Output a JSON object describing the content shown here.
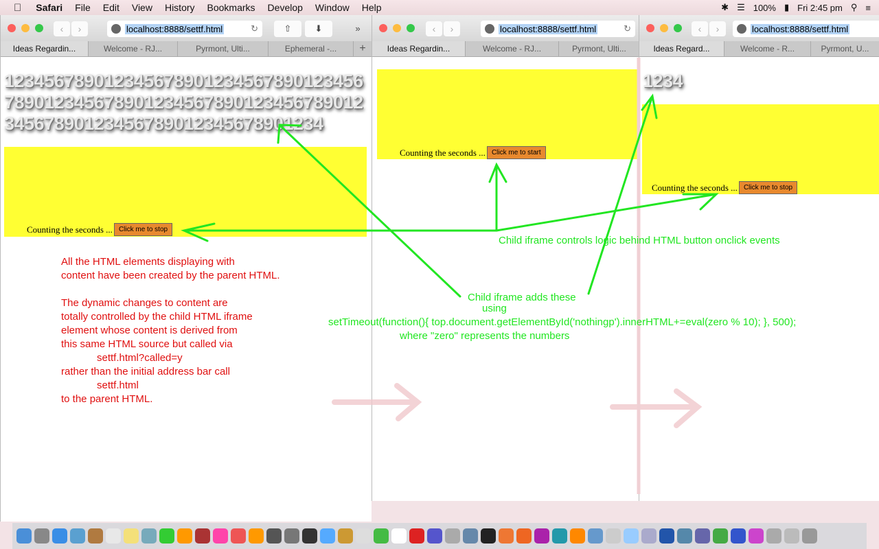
{
  "menubar": {
    "app": "Safari",
    "items": [
      "File",
      "Edit",
      "View",
      "History",
      "Bookmarks",
      "Develop",
      "Window",
      "Help"
    ],
    "battery": "100%",
    "clock": "Fri 2:45 pm"
  },
  "windows": [
    {
      "url": "localhost:8888/settf.html",
      "tabs": [
        "Ideas Regardin...",
        "Welcome - RJ...",
        "Pyrmont, Ulti...",
        "Ephemeral -..."
      ],
      "digits": "12345678901234567890123456789012345678901234567890123456789012345678901234567890123456789012345678901234",
      "count_text": "Counting the seconds ...",
      "button": "Click me to stop"
    },
    {
      "url": "localhost:8888/settf.html",
      "tabs": [
        "Ideas Regardin...",
        "Welcome - RJ...",
        "Pyrmont, Ulti..."
      ],
      "count_text": "Counting the seconds ...",
      "button": "Click me to start"
    },
    {
      "url": "localhost:8888/settf.html",
      "tabs": [
        "Ideas Regard...",
        "Welcome - R...",
        "Pyrmont, U..."
      ],
      "digits": "1234",
      "count_text": "Counting the seconds ...",
      "button": "Click me to stop"
    }
  ],
  "annotations": {
    "red": [
      "All the HTML elements displaying with",
      "content have been created by the parent HTML.",
      "The dynamic changes to content are",
      "totally controlled by the child HTML iframe",
      "element whose content is derived from",
      "this same HTML source but called via",
      "settf.html?called=y",
      "rather than the initial address bar call",
      "settf.html",
      "to the parent HTML."
    ],
    "green_top": "Child iframe controls logic behind HTML button onclick events",
    "green_1": "Child iframe adds these",
    "green_2": "using",
    "green_3": "setTimeout(function(){ top.document.getElementById('nothingp').innerHTML+=eval(zero % 10); }, 500);",
    "green_4": "where \"zero\" represents the numbers"
  },
  "colors": {
    "annotation_red": "#e01010",
    "annotation_green": "#22e622",
    "yellow": "#ffff33",
    "button": "#e8892e"
  }
}
